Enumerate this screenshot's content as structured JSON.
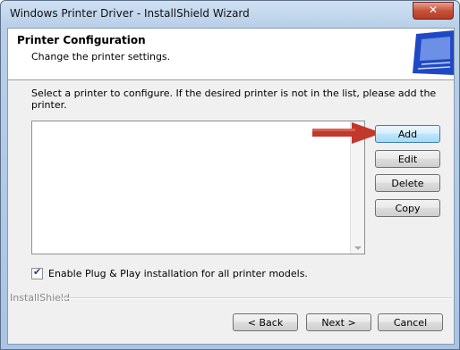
{
  "window": {
    "title": "Windows Printer Driver - InstallShield Wizard",
    "close_glyph": "✕"
  },
  "header": {
    "title": "Printer Configuration",
    "subtitle": "Change the printer settings."
  },
  "instruction": "Select a printer to configure. If the desired printer is not in the list, please add the printer.",
  "printer_list": {
    "items": []
  },
  "side_buttons": {
    "add": "Add",
    "edit": "Edit",
    "delete": "Delete",
    "copy": "Copy"
  },
  "pnp_checkbox": {
    "checked": true,
    "check_glyph": "✔",
    "label": "Enable Plug & Play installation for all printer models."
  },
  "brand": "InstallShield",
  "footer_buttons": {
    "back": "< Back",
    "next": "Next >",
    "cancel": "Cancel"
  },
  "colors": {
    "arrow": "#c0392b",
    "header_art": "#2a55c9"
  }
}
